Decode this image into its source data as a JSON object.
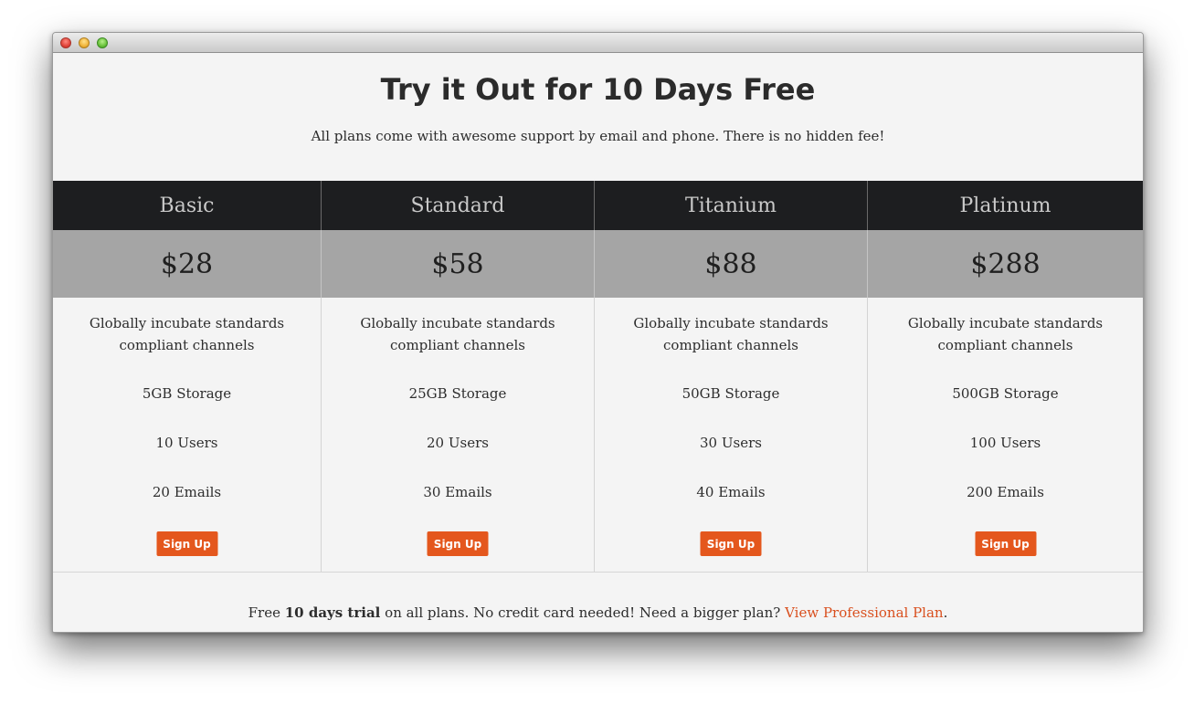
{
  "hero": {
    "title": "Try it Out for 10 Days Free",
    "subtitle": "All plans come with awesome support by email and phone. There is no hidden fee!"
  },
  "plans": [
    {
      "name": "Basic",
      "price": "$28",
      "description": "Globally incubate standards compliant channels",
      "storage": "5GB Storage",
      "users": "10 Users",
      "emails": "20 Emails",
      "button": "Sign Up"
    },
    {
      "name": "Standard",
      "price": "$58",
      "description": "Globally incubate standards compliant channels",
      "storage": "25GB Storage",
      "users": "20 Users",
      "emails": "30 Emails",
      "button": "Sign Up"
    },
    {
      "name": "Titanium",
      "price": "$88",
      "description": "Globally incubate standards compliant channels",
      "storage": "50GB Storage",
      "users": "30 Users",
      "emails": "40 Emails",
      "button": "Sign Up"
    },
    {
      "name": "Platinum",
      "price": "$288",
      "description": "Globally incubate standards compliant channels",
      "storage": "500GB Storage",
      "users": "100 Users",
      "emails": "200 Emails",
      "button": "Sign Up"
    }
  ],
  "footer": {
    "prefix": "Free ",
    "bold": "10 days trial",
    "middle": " on all plans. No credit card needed! Need a bigger plan? ",
    "link": "View Professional Plan",
    "suffix": "."
  },
  "colors": {
    "accent": "#e4571d",
    "link": "#d9501f",
    "header_bg": "#1d1e20",
    "price_bg": "#a5a5a5",
    "page_bg": "#f4f4f4"
  }
}
